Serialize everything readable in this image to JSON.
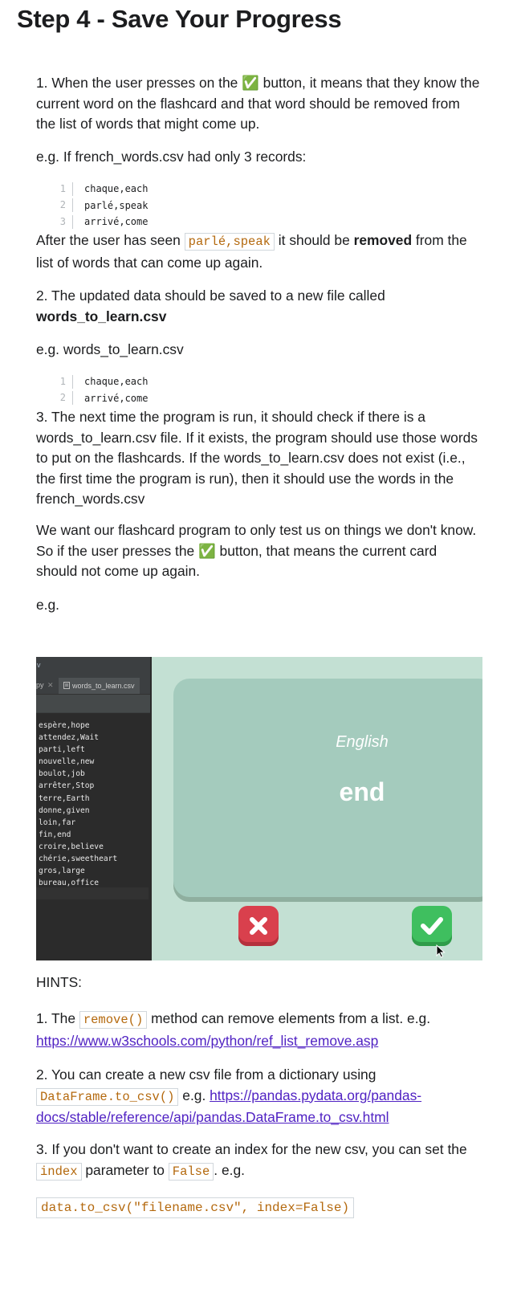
{
  "title": "Step 4 - Save Your Progress",
  "p1": {
    "before": "1. When the user presses on the ",
    "emoji": "✅",
    "after": " button, it means that they know the current word on the flashcard and that word should be removed from the list of words that might come up."
  },
  "p2": "e.g. If french_words.csv had only 3 records:",
  "code1": [
    {
      "num": "1",
      "text": "chaque,each"
    },
    {
      "num": "2",
      "text": "parlé,speak"
    },
    {
      "num": "3",
      "text": "arrivé,come"
    }
  ],
  "p3": {
    "before": "After the user has seen ",
    "code": "parlé,speak",
    "middle": " it should be ",
    "bold": "removed",
    "after": " from the list of words that can come up again."
  },
  "p4": {
    "text": "2. The updated data should be saved to a new file called ",
    "bold": "words_to_learn.csv"
  },
  "p5": "e.g. words_to_learn.csv",
  "code2": [
    {
      "num": "1",
      "text": "chaque,each"
    },
    {
      "num": "2",
      "text": "arrivé,come"
    }
  ],
  "p6": "3. The next time the program is run, it should check if there is a words_to_learn.csv file. If it exists, the program should use those words to put on the flashcards. If the words_to_learn.csv does not exist (i.e., the first time the program is run), then it should use the words in the french_words.csv",
  "p7": {
    "before": "We want our flashcard program to only test us on things we don't know. So if the user presses the ",
    "emoji": "✅",
    "after": " button, that means the current card should not come up again."
  },
  "p8": "e.g.",
  "screenshot": {
    "ide_top": "v",
    "tab_prev": "py",
    "tab_close": "✕",
    "tab_file": "words_to_learn.csv",
    "lines": [
      "espère,hope",
      "attendez,Wait",
      "parti,left",
      "nouvelle,new",
      "boulot,job",
      "arrêter,Stop",
      "terre,Earth",
      "donne,given",
      "loin,far",
      "fin,end",
      "croire,believe",
      "chérie,sweetheart",
      "gros,large",
      "bureau,office"
    ],
    "card_language": "English",
    "card_word": "end"
  },
  "hints_title": "HINTS:",
  "hint1": {
    "before": "1. The ",
    "code": "remove()",
    "after": " method can remove elements from a list. e.g. ",
    "link": "https://www.w3schools.com/python/ref_list_remove.asp"
  },
  "hint2": {
    "before": "2. You can create a new csv file from a dictionary using ",
    "code": "DataFrame.to_csv()",
    "middle": " e.g. ",
    "link": "https://pandas.pydata.org/pandas-docs/stable/reference/api/pandas.DataFrame.to_csv.html"
  },
  "hint3": {
    "before": "3. If you don't want to create an index for the new csv, you can set the ",
    "code1": "index",
    "middle": " parameter to ",
    "code2": "False",
    "after": ". e.g."
  },
  "snippet": "data.to_csv(\"filename.csv\", index=False)",
  "colors": {
    "accent_code": "#b4690e",
    "link": "#5022c3",
    "card": "#a4cbbd",
    "background_app": "#c3e0d3"
  }
}
